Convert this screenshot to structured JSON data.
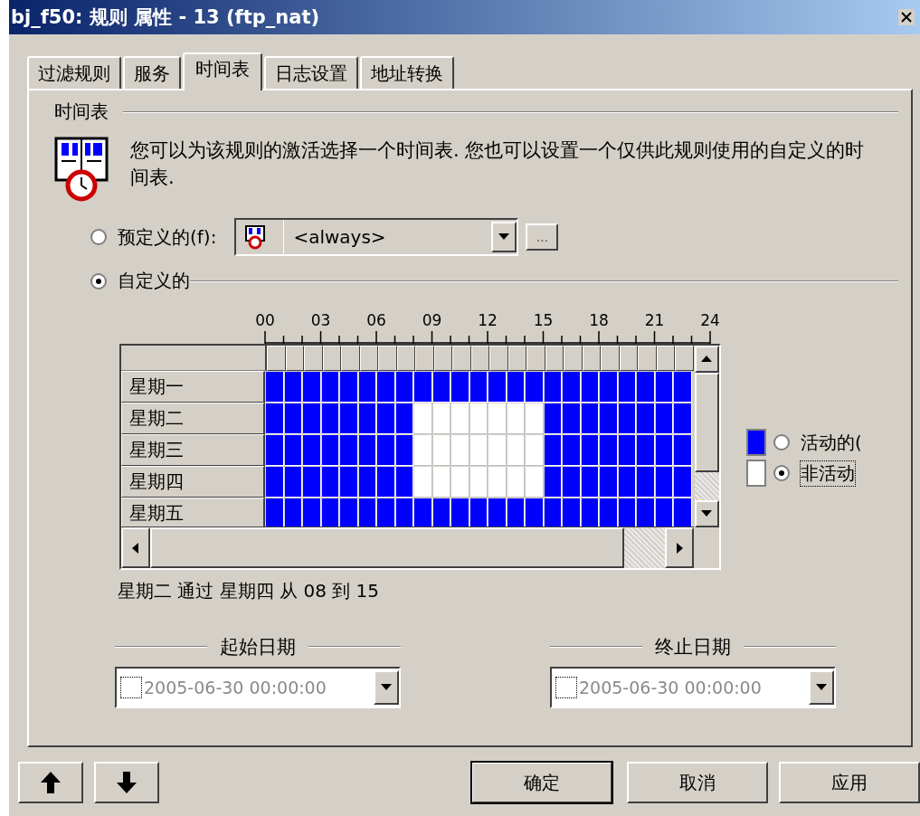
{
  "window": {
    "title": "bj_f50: 规则 属性 - 13 (ftp_nat)"
  },
  "tabs": [
    {
      "label": "过滤规则",
      "selected": false
    },
    {
      "label": "服务",
      "selected": false
    },
    {
      "label": "时间表",
      "selected": true
    },
    {
      "label": "日志设置",
      "selected": false
    },
    {
      "label": "地址转换",
      "selected": false
    }
  ],
  "section": {
    "heading": "时间表",
    "description": "您可以为该规则的激活选择一个时间表. 您也可以设置一个仅供此规则使用的自定义的时间表."
  },
  "predefined": {
    "label": "预定义的(f):",
    "selected": false,
    "value": "<always>",
    "browse": "..."
  },
  "custom": {
    "label": "自定义的",
    "selected": true
  },
  "grid": {
    "hour_labels": [
      "00",
      "03",
      "06",
      "09",
      "12",
      "15",
      "18",
      "21",
      "24"
    ],
    "rows": [
      {
        "day": "星期一",
        "active": [
          true,
          true,
          true,
          true,
          true,
          true,
          true,
          true,
          true,
          true,
          true,
          true,
          true,
          true,
          true,
          true,
          true,
          true,
          true,
          true,
          true,
          true,
          true
        ]
      },
      {
        "day": "星期二",
        "active": [
          true,
          true,
          true,
          true,
          true,
          true,
          true,
          true,
          false,
          false,
          false,
          false,
          false,
          false,
          false,
          true,
          true,
          true,
          true,
          true,
          true,
          true,
          true
        ]
      },
      {
        "day": "星期三",
        "active": [
          true,
          true,
          true,
          true,
          true,
          true,
          true,
          true,
          false,
          false,
          false,
          false,
          false,
          false,
          false,
          true,
          true,
          true,
          true,
          true,
          true,
          true,
          true
        ]
      },
      {
        "day": "星期四",
        "active": [
          true,
          true,
          true,
          true,
          true,
          true,
          true,
          true,
          false,
          false,
          false,
          false,
          false,
          false,
          false,
          true,
          true,
          true,
          true,
          true,
          true,
          true,
          true
        ]
      },
      {
        "day": "星期五",
        "active": [
          true,
          true,
          true,
          true,
          true,
          true,
          true,
          true,
          true,
          true,
          true,
          true,
          true,
          true,
          true,
          true,
          true,
          true,
          true,
          true,
          true,
          true,
          true
        ]
      }
    ]
  },
  "legend": [
    {
      "label": "活动的(",
      "color": "#0000ff",
      "selected": false
    },
    {
      "label": "非活动",
      "color": "#ffffff",
      "selected": true
    }
  ],
  "summary": "星期二 通过 星期四 从 08 到 15",
  "dates": [
    {
      "label": "起始日期",
      "value": "2005-06-30 00:00:00",
      "checked": false
    },
    {
      "label": "终止日期",
      "value": "2005-06-30 00:00:00",
      "checked": false
    }
  ],
  "buttons": [
    {
      "label": "确定",
      "default": true
    },
    {
      "label": "取消",
      "default": false
    },
    {
      "label": "应用",
      "default": false
    }
  ]
}
